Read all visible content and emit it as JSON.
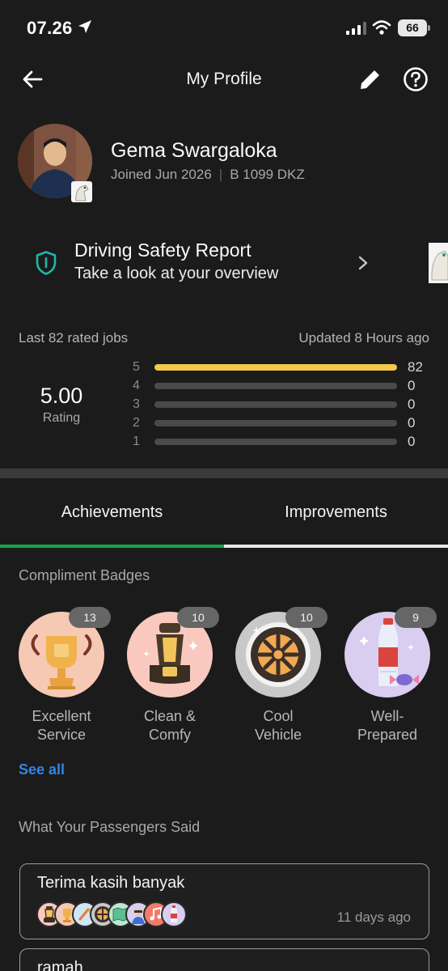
{
  "status_bar": {
    "time": "07.26",
    "battery": "66"
  },
  "header": {
    "title": "My Profile"
  },
  "profile": {
    "name": "Gema Swargaloka",
    "joined": "Joined Jun 2026",
    "plate": "B 1099 DKZ"
  },
  "safety_report": {
    "title": "Driving Safety Report",
    "subtitle": "Take a look at your overview"
  },
  "ratings": {
    "jobs_label": "Last 82 rated jobs",
    "updated": "Updated 8 Hours ago",
    "value": "5.00",
    "caption": "Rating",
    "distribution": [
      {
        "star": "5",
        "count": "82",
        "fraction": 1.0
      },
      {
        "star": "4",
        "count": "0",
        "fraction": 0
      },
      {
        "star": "3",
        "count": "0",
        "fraction": 0
      },
      {
        "star": "2",
        "count": "0",
        "fraction": 0
      },
      {
        "star": "1",
        "count": "0",
        "fraction": 0
      }
    ]
  },
  "tabs": [
    {
      "label": "Achievements",
      "active": true
    },
    {
      "label": "Improvements",
      "active": false
    }
  ],
  "badges": {
    "title": "Compliment Badges",
    "items": [
      {
        "label": "Excellent\nService",
        "count": "13",
        "icon": "trophy-icon",
        "bg": "#f6c9b4"
      },
      {
        "label": "Clean &\nComfy",
        "count": "10",
        "icon": "car-seat-icon",
        "bg": "#f9c9c0"
      },
      {
        "label": "Cool\nVehicle",
        "count": "10",
        "icon": "wheel-icon",
        "bg": "#c8c8c8"
      },
      {
        "label": "Well-\nPrepared",
        "count": "9",
        "icon": "water-bottle-icon",
        "bg": "#d9cdf0"
      }
    ],
    "see_all": "See all"
  },
  "passengers": {
    "title": "What Your Passengers Said",
    "reviews": [
      {
        "text": "Terima kasih banyak",
        "time": "11 days ago"
      },
      {
        "text": "ramah"
      }
    ]
  }
}
